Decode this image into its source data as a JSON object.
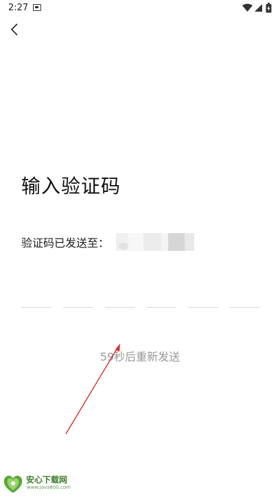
{
  "status_bar": {
    "time": "2:27",
    "icons": [
      "notification-icon",
      "wifi-icon",
      "signal-icon",
      "battery-icon"
    ]
  },
  "nav": {
    "back_icon": "chevron-left-icon"
  },
  "main": {
    "title": "输入验证码",
    "sent_label": "验证码已发送至：",
    "code_length": 6,
    "resend_text": "59秒后重新发送"
  },
  "watermark": {
    "title": "安心下载网",
    "url": "www.java800.com",
    "brand_color": "#3f7d2a"
  },
  "colors": {
    "annotation_arrow": "#d92b2b",
    "muted_text": "#999999",
    "underline": "#d8d8d8"
  }
}
